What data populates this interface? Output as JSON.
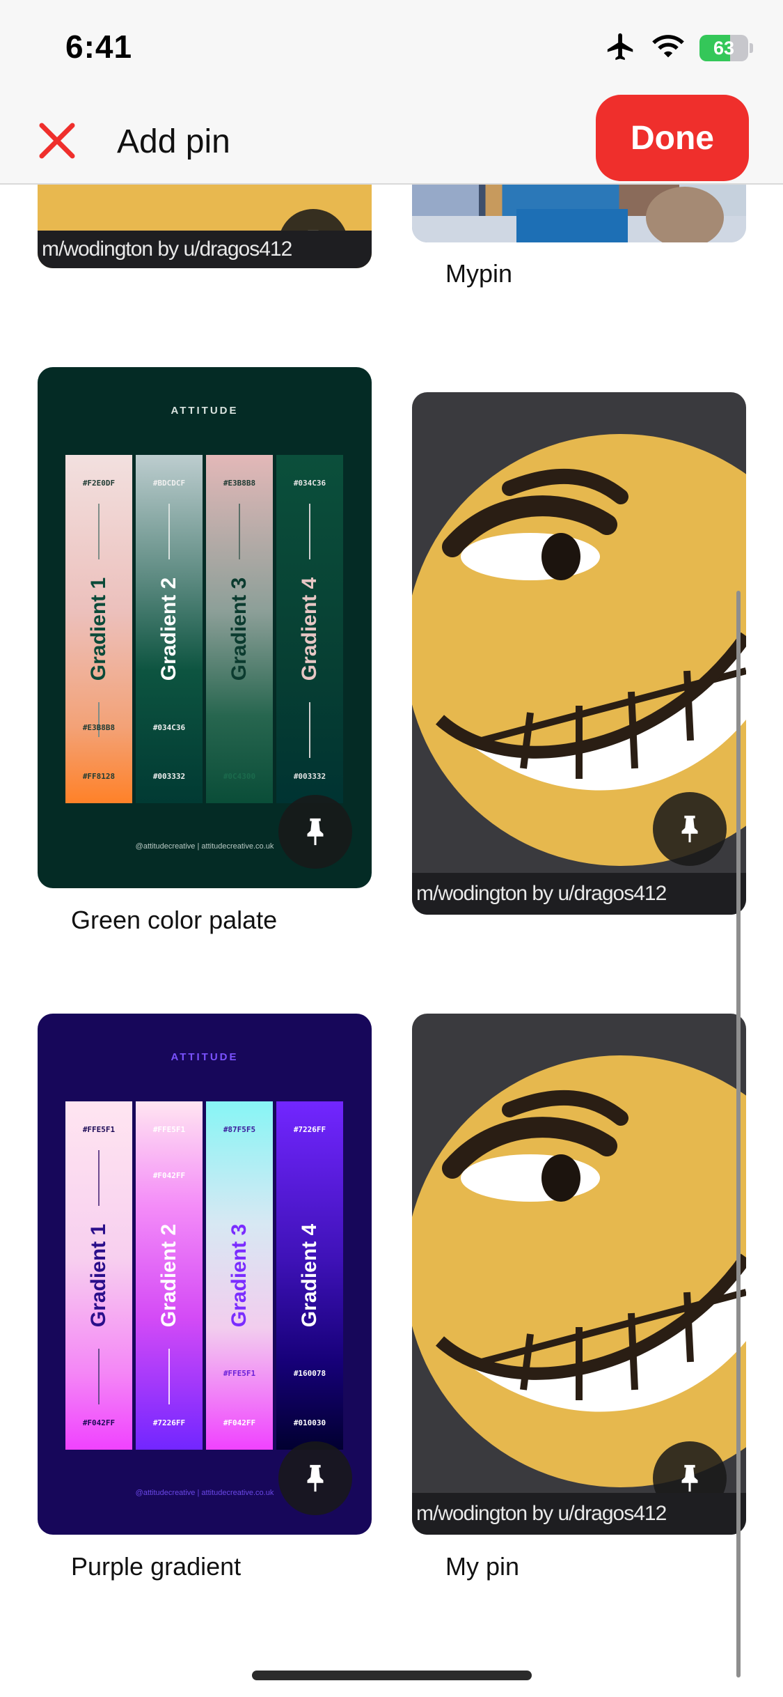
{
  "status_bar": {
    "time": "6:41",
    "battery": "63"
  },
  "header": {
    "title": "Add pin",
    "done_label": "Done"
  },
  "pins": {
    "top_left": {
      "watermark": "m/wodington by u/dragos412"
    },
    "top_right": {
      "label": "Mypin"
    },
    "green": {
      "label": "Green color palate",
      "brand": "ATTITUDE",
      "footer": "@attitudecreative | attitudecreative.co.uk",
      "strips": [
        {
          "name": "Gradient 1",
          "hexes": [
            "#F2E0DF",
            "#E3B8B8",
            "#FF8128"
          ]
        },
        {
          "name": "Gradient 2",
          "hexes": [
            "#BDCDCF",
            "#034C36",
            "#003332"
          ]
        },
        {
          "name": "Gradient 3",
          "hexes": [
            "#E3B8B8",
            "#0C4300"
          ]
        },
        {
          "name": "Gradient 4",
          "hexes": [
            "#034C36",
            "#003332"
          ]
        }
      ]
    },
    "emoji_mid": {
      "watermark": "m/wodington by u/dragos412"
    },
    "purple": {
      "label": "Purple gradient",
      "brand": "ATTITUDE",
      "footer": "@attitudecreative | attitudecreative.co.uk",
      "strips": [
        {
          "name": "Gradient 1",
          "hexes": [
            "#FFE5F1",
            "#F042FF"
          ]
        },
        {
          "name": "Gradient 2",
          "hexes": [
            "#FFE5F1",
            "#F042FF",
            "#7226FF"
          ]
        },
        {
          "name": "Gradient 3",
          "hexes": [
            "#87F5F5",
            "#FFE5F1",
            "#F042FF"
          ]
        },
        {
          "name": "Gradient 4",
          "hexes": [
            "#7226FF",
            "#160078",
            "#010030"
          ]
        }
      ]
    },
    "emoji_bottom": {
      "label": "My pin",
      "watermark": "m/wodington by u/dragos412"
    }
  },
  "colors": {
    "accent": "#ef2f2c",
    "battery_green": "#34c759"
  }
}
